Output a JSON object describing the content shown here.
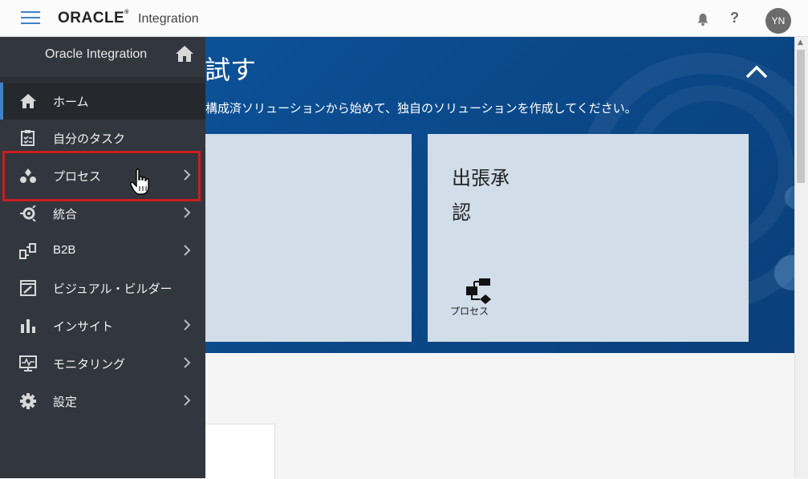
{
  "header": {
    "brand": "ORACLE",
    "brand_mark": "®",
    "product": "Integration",
    "help": "?",
    "avatar_initials": "YN"
  },
  "banner": {
    "title": "試す",
    "subtitle": "構成済ソリューションから始めて、独自のソリューションを作成してください。",
    "card": {
      "title_line1": "出張承",
      "title_line2": "認",
      "icon": "process-icon",
      "caption": "プロセス"
    }
  },
  "sidebar": {
    "title": "Oracle Integration",
    "items": [
      {
        "label": "ホーム",
        "icon": "home-icon",
        "active": true,
        "submenu": false
      },
      {
        "label": "自分のタスク",
        "icon": "tasks-icon",
        "active": false,
        "submenu": false
      },
      {
        "label": "プロセス",
        "icon": "process-icon",
        "active": false,
        "submenu": true
      },
      {
        "label": "統合",
        "icon": "integration-icon",
        "active": false,
        "submenu": true
      },
      {
        "label": "B2B",
        "icon": "b2b-icon",
        "active": false,
        "submenu": true
      },
      {
        "label": "ビジュアル・ビルダー",
        "icon": "visual-builder-icon",
        "active": false,
        "submenu": false
      },
      {
        "label": "インサイト",
        "icon": "insight-icon",
        "active": false,
        "submenu": true
      },
      {
        "label": "モニタリング",
        "icon": "monitoring-icon",
        "active": false,
        "submenu": true
      },
      {
        "label": "設定",
        "icon": "settings-icon",
        "active": false,
        "submenu": true
      }
    ]
  },
  "colors": {
    "accent": "#3f82c8",
    "sidebar_bg": "#32363e",
    "banner_bg": "#0b4a8c",
    "card_bg": "#d1dde8",
    "highlight": "#cc1e1e"
  }
}
